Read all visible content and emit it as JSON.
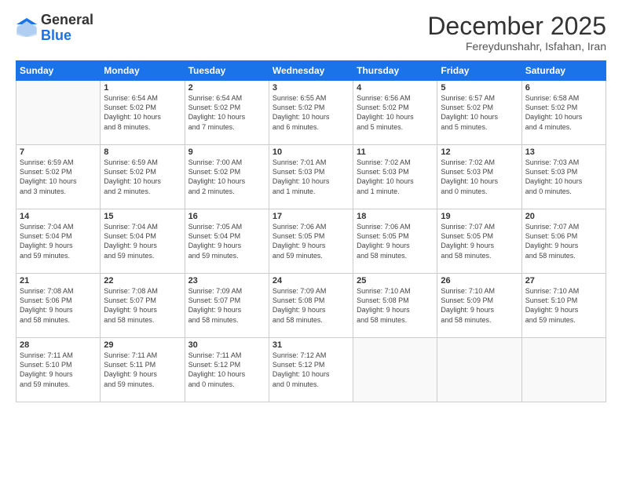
{
  "header": {
    "logo_line1": "General",
    "logo_line2": "Blue",
    "month": "December 2025",
    "location": "Fereydunshahr, Isfahan, Iran"
  },
  "days_of_week": [
    "Sunday",
    "Monday",
    "Tuesday",
    "Wednesday",
    "Thursday",
    "Friday",
    "Saturday"
  ],
  "weeks": [
    [
      {
        "day": "",
        "info": ""
      },
      {
        "day": "1",
        "info": "Sunrise: 6:54 AM\nSunset: 5:02 PM\nDaylight: 10 hours\nand 8 minutes."
      },
      {
        "day": "2",
        "info": "Sunrise: 6:54 AM\nSunset: 5:02 PM\nDaylight: 10 hours\nand 7 minutes."
      },
      {
        "day": "3",
        "info": "Sunrise: 6:55 AM\nSunset: 5:02 PM\nDaylight: 10 hours\nand 6 minutes."
      },
      {
        "day": "4",
        "info": "Sunrise: 6:56 AM\nSunset: 5:02 PM\nDaylight: 10 hours\nand 5 minutes."
      },
      {
        "day": "5",
        "info": "Sunrise: 6:57 AM\nSunset: 5:02 PM\nDaylight: 10 hours\nand 5 minutes."
      },
      {
        "day": "6",
        "info": "Sunrise: 6:58 AM\nSunset: 5:02 PM\nDaylight: 10 hours\nand 4 minutes."
      }
    ],
    [
      {
        "day": "7",
        "info": "Sunrise: 6:59 AM\nSunset: 5:02 PM\nDaylight: 10 hours\nand 3 minutes."
      },
      {
        "day": "8",
        "info": "Sunrise: 6:59 AM\nSunset: 5:02 PM\nDaylight: 10 hours\nand 2 minutes."
      },
      {
        "day": "9",
        "info": "Sunrise: 7:00 AM\nSunset: 5:02 PM\nDaylight: 10 hours\nand 2 minutes."
      },
      {
        "day": "10",
        "info": "Sunrise: 7:01 AM\nSunset: 5:03 PM\nDaylight: 10 hours\nand 1 minute."
      },
      {
        "day": "11",
        "info": "Sunrise: 7:02 AM\nSunset: 5:03 PM\nDaylight: 10 hours\nand 1 minute."
      },
      {
        "day": "12",
        "info": "Sunrise: 7:02 AM\nSunset: 5:03 PM\nDaylight: 10 hours\nand 0 minutes."
      },
      {
        "day": "13",
        "info": "Sunrise: 7:03 AM\nSunset: 5:03 PM\nDaylight: 10 hours\nand 0 minutes."
      }
    ],
    [
      {
        "day": "14",
        "info": "Sunrise: 7:04 AM\nSunset: 5:04 PM\nDaylight: 9 hours\nand 59 minutes."
      },
      {
        "day": "15",
        "info": "Sunrise: 7:04 AM\nSunset: 5:04 PM\nDaylight: 9 hours\nand 59 minutes."
      },
      {
        "day": "16",
        "info": "Sunrise: 7:05 AM\nSunset: 5:04 PM\nDaylight: 9 hours\nand 59 minutes."
      },
      {
        "day": "17",
        "info": "Sunrise: 7:06 AM\nSunset: 5:05 PM\nDaylight: 9 hours\nand 59 minutes."
      },
      {
        "day": "18",
        "info": "Sunrise: 7:06 AM\nSunset: 5:05 PM\nDaylight: 9 hours\nand 58 minutes."
      },
      {
        "day": "19",
        "info": "Sunrise: 7:07 AM\nSunset: 5:05 PM\nDaylight: 9 hours\nand 58 minutes."
      },
      {
        "day": "20",
        "info": "Sunrise: 7:07 AM\nSunset: 5:06 PM\nDaylight: 9 hours\nand 58 minutes."
      }
    ],
    [
      {
        "day": "21",
        "info": "Sunrise: 7:08 AM\nSunset: 5:06 PM\nDaylight: 9 hours\nand 58 minutes."
      },
      {
        "day": "22",
        "info": "Sunrise: 7:08 AM\nSunset: 5:07 PM\nDaylight: 9 hours\nand 58 minutes."
      },
      {
        "day": "23",
        "info": "Sunrise: 7:09 AM\nSunset: 5:07 PM\nDaylight: 9 hours\nand 58 minutes."
      },
      {
        "day": "24",
        "info": "Sunrise: 7:09 AM\nSunset: 5:08 PM\nDaylight: 9 hours\nand 58 minutes."
      },
      {
        "day": "25",
        "info": "Sunrise: 7:10 AM\nSunset: 5:08 PM\nDaylight: 9 hours\nand 58 minutes."
      },
      {
        "day": "26",
        "info": "Sunrise: 7:10 AM\nSunset: 5:09 PM\nDaylight: 9 hours\nand 58 minutes."
      },
      {
        "day": "27",
        "info": "Sunrise: 7:10 AM\nSunset: 5:10 PM\nDaylight: 9 hours\nand 59 minutes."
      }
    ],
    [
      {
        "day": "28",
        "info": "Sunrise: 7:11 AM\nSunset: 5:10 PM\nDaylight: 9 hours\nand 59 minutes."
      },
      {
        "day": "29",
        "info": "Sunrise: 7:11 AM\nSunset: 5:11 PM\nDaylight: 9 hours\nand 59 minutes."
      },
      {
        "day": "30",
        "info": "Sunrise: 7:11 AM\nSunset: 5:12 PM\nDaylight: 10 hours\nand 0 minutes."
      },
      {
        "day": "31",
        "info": "Sunrise: 7:12 AM\nSunset: 5:12 PM\nDaylight: 10 hours\nand 0 minutes."
      },
      {
        "day": "",
        "info": ""
      },
      {
        "day": "",
        "info": ""
      },
      {
        "day": "",
        "info": ""
      }
    ]
  ]
}
